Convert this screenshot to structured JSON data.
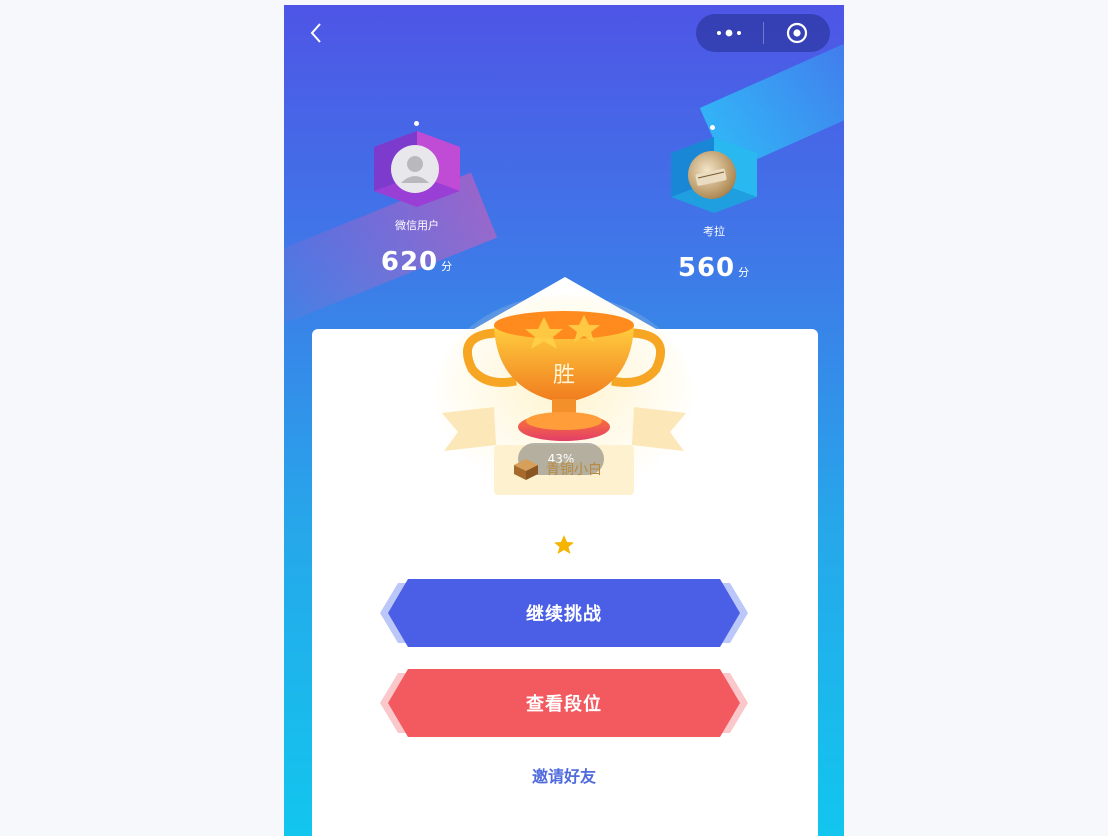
{
  "header": {
    "back_icon": "chevron-left-icon",
    "more_icon": "more-dots-icon",
    "close_icon": "target-close-icon"
  },
  "players": [
    {
      "name": "微信用户",
      "score": "620",
      "unit": "分",
      "cube_color": "#c04cd6",
      "avatar": "default-user-icon"
    },
    {
      "name": "考拉",
      "score": "560",
      "unit": "分",
      "cube_color": "#2ab8f0",
      "avatar": "user-photo"
    }
  ],
  "result": {
    "trophy_text": "胜",
    "progress": "43%",
    "rank_name": "青铜小白",
    "stars": 1
  },
  "actions": {
    "continue_label": "继续挑战",
    "rank_label": "查看段位",
    "invite_label": "邀请好友"
  },
  "colors": {
    "continue": "#4a5ee6",
    "rank": "#f35a5f",
    "invite": "#4f6bdc",
    "star": "#f5b400"
  }
}
